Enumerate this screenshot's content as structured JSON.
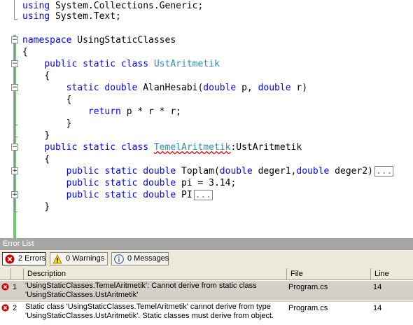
{
  "editor": {
    "lines": [
      {
        "indent": "",
        "kw": "using",
        "rest": " System.Collections.Generic;"
      },
      {
        "indent": "",
        "kw": "using",
        "rest": " System.Text;"
      }
    ],
    "ns_kw": "namespace",
    "ns_name": " UsingStaticClasses",
    "brace_open": "{",
    "brace_close": "}",
    "c1_kw": "public static class ",
    "c1_name": "UstAritmetik",
    "m1_kw1": "static double ",
    "m1_name": "AlanHesabi(",
    "m1_kw2": "double",
    "m1_p": " p, ",
    "m1_kw3": "double",
    "m1_r": " r)",
    "ret_kw": "return",
    "ret_rest": " p * r * r;",
    "c2_kw": "public static class ",
    "c2_name": "TemelAritmetik",
    "c2_colon": ":UstAritmetik",
    "m2_kw": "public static double ",
    "m2_name": "Toplam(",
    "m2_kw2": "double",
    "m2_p1": " deger1,",
    "m2_kw3": "double",
    "m2_p2": " deger2)",
    "f_kw": "public static double ",
    "f_rest": "pi = 3.14;",
    "p_kw": "public static double ",
    "p_rest": "PI",
    "ellipsis": "..."
  },
  "error_list": {
    "title": "Error List",
    "filters": {
      "errors": "2 Errors",
      "warnings": "0 Warnings",
      "messages": "0 Messages"
    },
    "columns": {
      "description": "Description",
      "file": "File",
      "line": "Line"
    },
    "rows": [
      {
        "num": "1",
        "desc1": "'UsingStaticClasses.TemelAritmetik': Cannot derive from static class",
        "desc2": "'UsingStaticClasses.UstAritmetik'",
        "file": "Program.cs",
        "line": "14"
      },
      {
        "num": "2",
        "desc1": "Static class 'UsingStaticClasses.TemelAritmetik' cannot derive from type",
        "desc2": "'UsingStaticClasses.UstAritmetik'. Static classes must derive from object.",
        "file": "Program.cs",
        "line": "14"
      }
    ]
  },
  "colors": {
    "keyword": "#0000ff",
    "type": "#2b91af",
    "error_icon": "#cc0000",
    "change_bar": "#6cc86c"
  }
}
